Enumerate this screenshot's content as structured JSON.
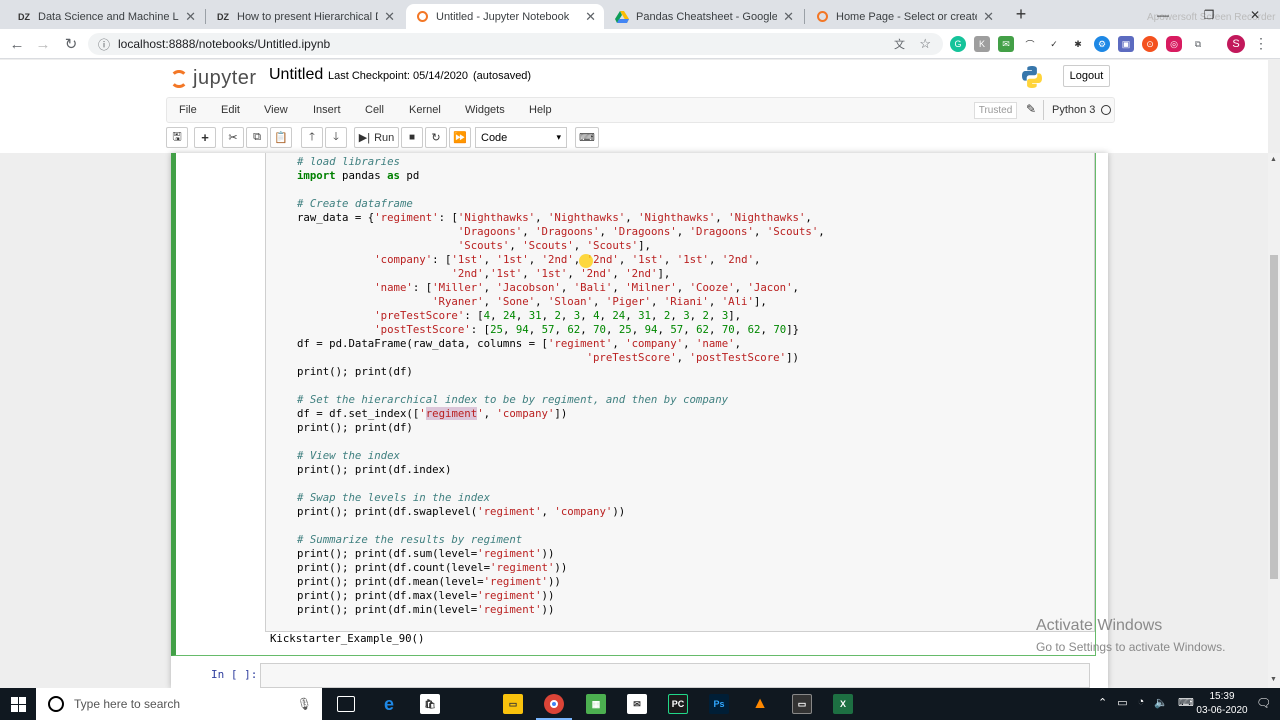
{
  "browser": {
    "tabs": [
      {
        "favicon": "DZ",
        "title": "Data Science and Machine Learni"
      },
      {
        "favicon": "DZ",
        "title": "How to present Hierarchical Data"
      },
      {
        "favicon": "jupyter-icon",
        "title": "Untitled - Jupyter Notebook"
      },
      {
        "favicon": "google-drive-icon",
        "title": "Pandas Cheatsheet - Google Driv"
      },
      {
        "favicon": "jupyter-icon",
        "title": "Home Page - Select or create a n"
      }
    ],
    "url": "localhost:8888/notebooks/Untitled.ipynb",
    "profile_initial": "S",
    "recorder_watermark": "Apowersoft Screen Recorder"
  },
  "jupyter": {
    "logo_text": "jupyter",
    "notebook_name": "Untitled",
    "checkpoint": "Last Checkpoint: 05/14/2020",
    "autosaved": "(autosaved)",
    "logout": "Logout",
    "menu": [
      "File",
      "Edit",
      "View",
      "Insert",
      "Cell",
      "Kernel",
      "Widgets",
      "Help"
    ],
    "trusted": "Trusted",
    "kernel_name": "Python 3",
    "toolbar": {
      "run": "Run",
      "cell_type": "Code"
    },
    "output_text": "Kickstarter_Example_90()",
    "new_cell_prompt": "In [ ]:"
  },
  "watermark": {
    "title": "Activate Windows",
    "subtitle": "Go to Settings to activate Windows."
  },
  "taskbar": {
    "search_placeholder": "Type here to search",
    "time": "15:39",
    "date": "03-06-2020"
  }
}
